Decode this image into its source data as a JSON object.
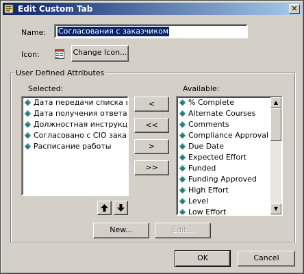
{
  "window": {
    "title": "Edit Custom Tab",
    "close_glyph": "✕"
  },
  "form": {
    "name_label": "Name:",
    "name_value": "Согласования с заказчиком",
    "icon_label": "Icon:",
    "change_icon_button": "Change Icon..."
  },
  "attributes": {
    "group_title": "User Defined Attributes",
    "selected_label": "Selected:",
    "available_label": "Available:",
    "selected_items": [
      "Дата передачи списка вопросов",
      "Дата получения ответа",
      "Должностная инструкция",
      "Согласовано с CIO заказчика",
      "Расписание работы"
    ],
    "available_items": [
      "% Complete",
      "Alternate Courses",
      "Comments",
      "Compliance Approval",
      "Due Date",
      "Expected Effort",
      "Funded",
      "Funding Approved",
      "High Effort",
      "Level",
      "Low Effort"
    ],
    "move_buttons": {
      "remove_one": "<",
      "remove_all": "<<",
      "add_one": ">",
      "add_all": ">>"
    },
    "reorder": {
      "up": "🡅",
      "down": "🡇"
    },
    "new_button": "New...",
    "edit_button": "Edit..."
  },
  "footer": {
    "ok_button": "OK",
    "cancel_button": "Cancel"
  },
  "icons": {
    "app": "custom-tab-app-icon",
    "tab": "tab-page-icon",
    "item": "attribute-diamond-icon"
  },
  "colors": {
    "titlebar": "#0a246a",
    "selection": "#0a246a",
    "item_icon": "#2f7a78"
  }
}
